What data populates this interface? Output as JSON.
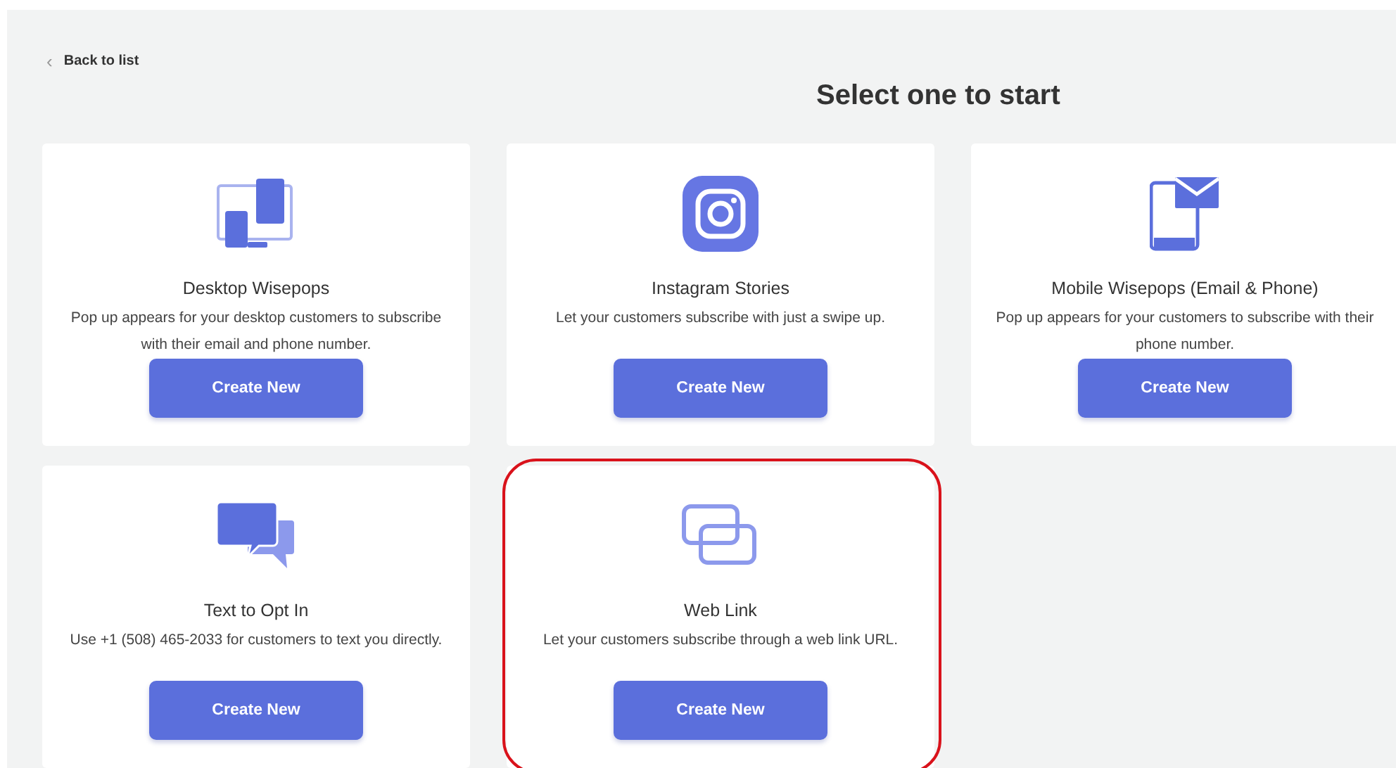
{
  "back_link": {
    "icon": "‹",
    "label": "Back to list"
  },
  "heading": "Select one to start",
  "cards": [
    {
      "kind": "desktop",
      "title": "Desktop Wisepops",
      "description": "Pop up appears for your desktop customers to subscribe with their email and phone number.",
      "button": "Create New",
      "highlighted": false
    },
    {
      "kind": "instagram",
      "title": "Instagram Stories",
      "description": "Let your customers subscribe with just a swipe up.",
      "button": "Create New",
      "highlighted": false
    },
    {
      "kind": "mobile",
      "title": "Mobile Wisepops (Email & Phone)",
      "description": "Pop up appears for your customers to subscribe with their phone number.",
      "button": "Create New",
      "highlighted": false
    },
    {
      "kind": "chat",
      "title": "Text to Opt In",
      "description": "Use +1 (508) 465-2033 for customers to text you directly.",
      "button": "Create New",
      "highlighted": false
    },
    {
      "kind": "link",
      "title": "Web Link",
      "description": "Let your customers subscribe through a web link URL.",
      "button": "Create New",
      "highlighted": true
    }
  ]
}
